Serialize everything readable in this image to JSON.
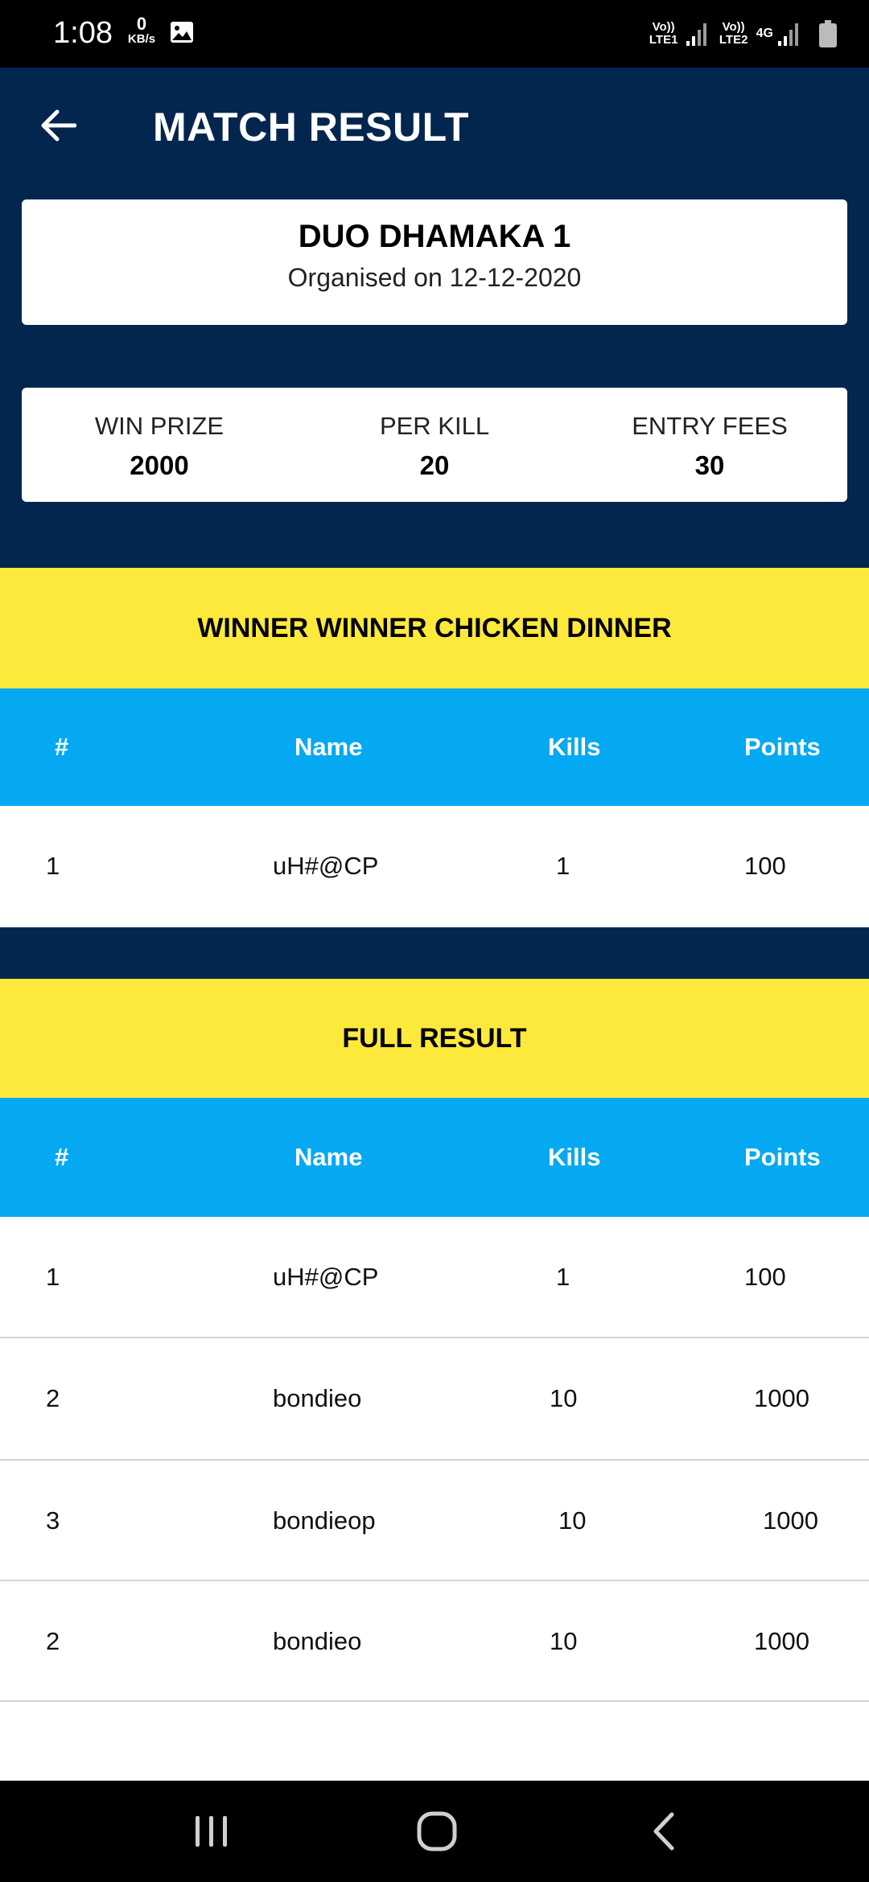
{
  "status_bar": {
    "time": "1:08",
    "net_speed_value": "0",
    "net_speed_unit": "KB/s",
    "sim1_label": "Vo)) LTE1",
    "sim2_label": "Vo)) LTE2",
    "network_type": "4G"
  },
  "header": {
    "title": "MATCH RESULT"
  },
  "match": {
    "name": "DUO DHAMAKA 1",
    "organised": "Organised on 12-12-2020"
  },
  "stats": {
    "win_prize_label": "WIN PRIZE",
    "win_prize_value": "2000",
    "per_kill_label": "PER KILL",
    "per_kill_value": "20",
    "entry_fees_label": "ENTRY FEES",
    "entry_fees_value": "30"
  },
  "winner_section": {
    "banner": "WINNER WINNER CHICKEN DINNER",
    "headers": {
      "rank": "#",
      "name": "Name",
      "kills": "Kills",
      "points": "Points"
    },
    "rows": [
      {
        "rank": "1",
        "name": "uH#@CP",
        "kills": "1",
        "points": "100"
      }
    ]
  },
  "full_section": {
    "banner": "FULL RESULT",
    "headers": {
      "rank": "#",
      "name": "Name",
      "kills": "Kills",
      "points": "Points"
    },
    "rows": [
      {
        "rank": "1",
        "name": "uH#@CP",
        "kills": "1",
        "points": "100"
      },
      {
        "rank": "2",
        "name": "bondieo",
        "kills": "10",
        "points": "1000"
      },
      {
        "rank": "3",
        "name": "bondieop",
        "kills": "10",
        "points": "1000"
      },
      {
        "rank": "2",
        "name": "bondieo",
        "kills": "10",
        "points": "1000"
      }
    ]
  },
  "colors": {
    "navy": "#02264e",
    "yellow": "#fde93b",
    "blue": "#04a9f1"
  },
  "icons": {
    "back": "arrow-left-icon",
    "nav_recents": "recents-icon",
    "nav_home": "home-icon",
    "nav_back": "back-chevron-icon"
  }
}
